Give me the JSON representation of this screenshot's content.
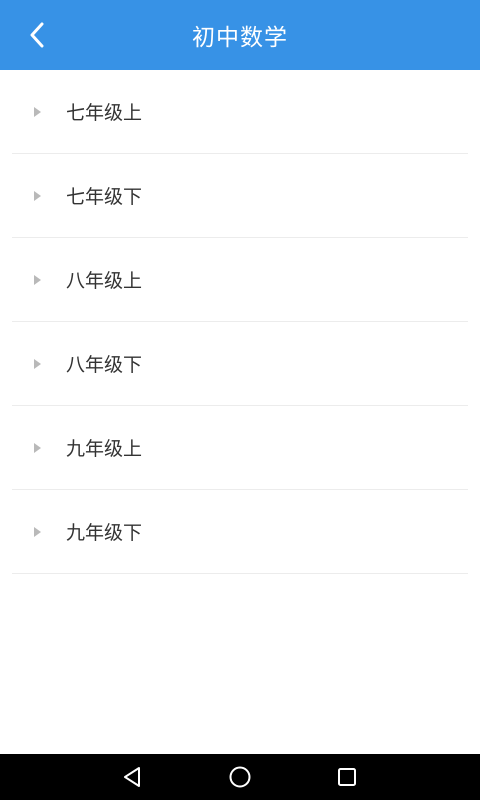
{
  "header": {
    "title": "初中数学",
    "back_icon": "back-chevron-icon",
    "background": "#3792E6"
  },
  "grades": {
    "items": [
      {
        "label": "七年级上"
      },
      {
        "label": "七年级下"
      },
      {
        "label": "八年级上"
      },
      {
        "label": "八年级下"
      },
      {
        "label": "九年级上"
      },
      {
        "label": "九年级下"
      }
    ]
  },
  "navbar": {
    "back_icon": "triangle-back-icon",
    "home_icon": "circle-home-icon",
    "recent_icon": "square-recent-icon"
  }
}
